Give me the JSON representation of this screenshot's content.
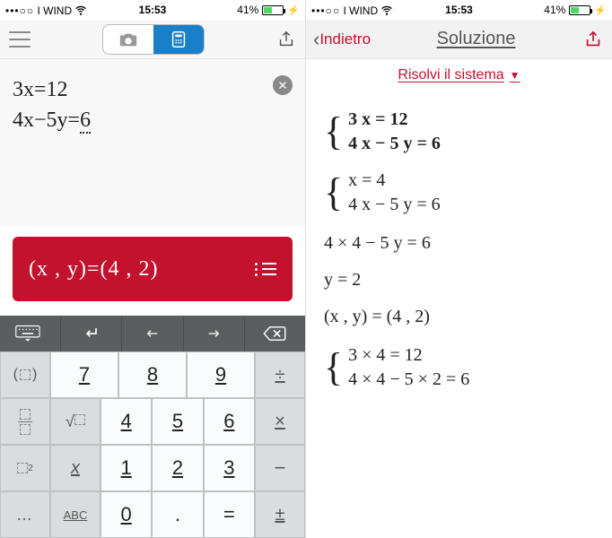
{
  "status": {
    "carrier": "I WIND",
    "signal": "•••○○",
    "wifi": "wifi",
    "time": "15:53",
    "battery_percent": "41%"
  },
  "left": {
    "mode": {
      "camera": "camera",
      "keypad": "keypad"
    },
    "editor": {
      "line1": "3x=12",
      "line2_pre": "4x−5y=",
      "line2_cursor": "6"
    },
    "result": "(x , y)=(4 , 2)",
    "toolbar": {
      "kbd": "⌨",
      "newline": "↵",
      "left": "←",
      "right": "→",
      "backspace": "⌫"
    },
    "keypad": {
      "r1": {
        "s1": "( )",
        "c1": "7",
        "c2": "8",
        "c3": "9",
        "s2": "÷"
      },
      "r2": {
        "s1": "frac",
        "c1": "4",
        "c2": "5",
        "c3": "6",
        "s2": "×"
      },
      "r3": {
        "s1": "pow",
        "sx": "x",
        "c1": "1",
        "c2": "2",
        "c3": "3",
        "s2": "−"
      },
      "r4": {
        "s1": "…",
        "sx": "ABC",
        "c1": "0",
        "c2": ".",
        "c3": "=",
        "s2": "±"
      }
    }
  },
  "right": {
    "back": "Indietro",
    "title": "Soluzione",
    "sub": "Risolvi il sistema",
    "steps": {
      "sys1_a": "3 x = 12",
      "sys1_b": "4 x − 5 y = 6",
      "sys2_a": "x = 4",
      "sys2_b": "4 x − 5 y = 6",
      "line3": "4 × 4 − 5 y = 6",
      "line4": "y = 2",
      "line5": "(x , y) = (4 , 2)",
      "sys3_a": "3 × 4 = 12",
      "sys3_b": "4 × 4 − 5 × 2 = 6"
    }
  }
}
